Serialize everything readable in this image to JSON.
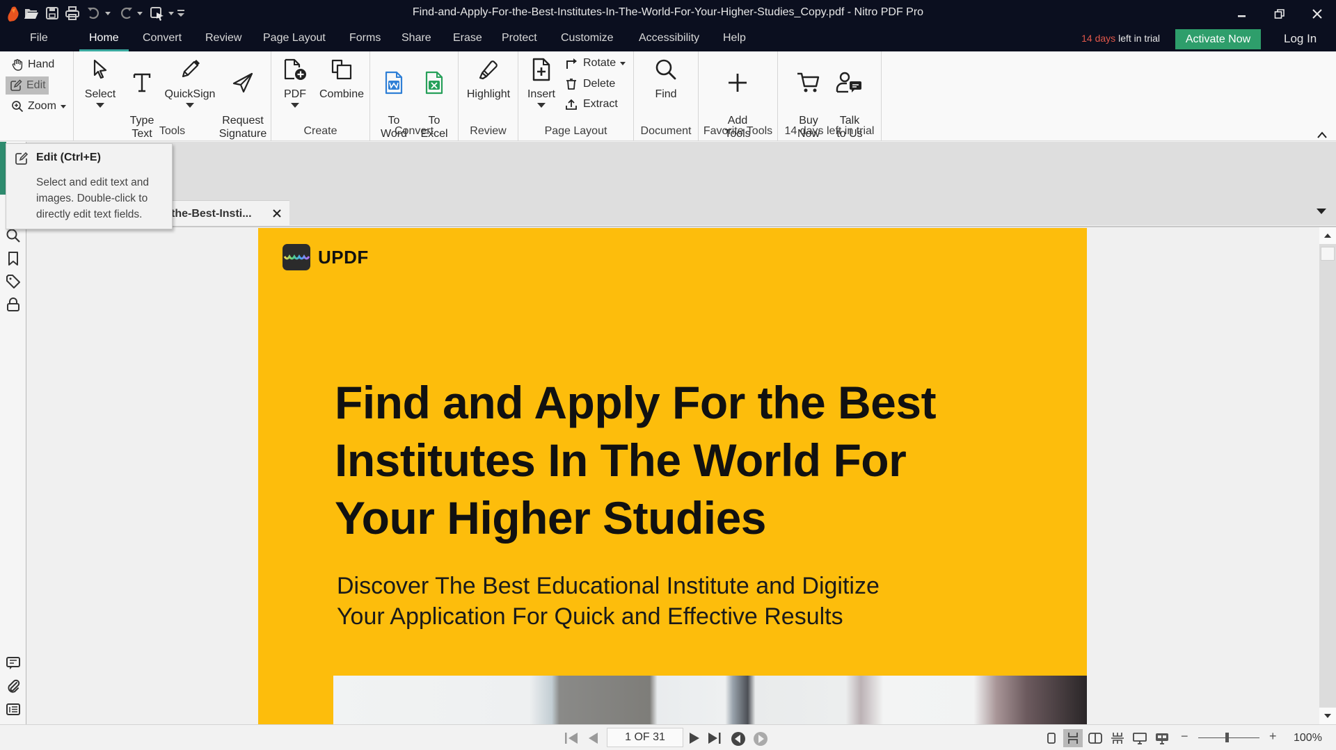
{
  "window": {
    "title": "Find-and-Apply-For-the-Best-Institutes-In-The-World-For-Your-Higher-Studies_Copy.pdf - Nitro PDF Pro",
    "app_name": "Nitro PDF Pro",
    "quick_access": [
      "nitro-logo",
      "open-folder",
      "save",
      "print",
      "undo",
      "redo",
      "select-customize",
      "overflow"
    ],
    "controls": [
      "minimize",
      "restore",
      "close"
    ]
  },
  "menu": {
    "tabs": [
      {
        "label": "File"
      },
      {
        "label": "Home",
        "active": true
      },
      {
        "label": "Convert"
      },
      {
        "label": "Review"
      },
      {
        "label": "Page Layout"
      },
      {
        "label": "Forms"
      },
      {
        "label": "Share"
      },
      {
        "label": "Erase"
      },
      {
        "label": "Protect"
      },
      {
        "label": "Customize"
      },
      {
        "label": "Accessibility"
      },
      {
        "label": "Help"
      }
    ],
    "trial_days": "14 days",
    "trial_suffix": " left in trial",
    "activate_label": "Activate Now",
    "login_label": "Log In",
    "colors": {
      "accent": "#3aa99f",
      "activate": "#2e9e6b",
      "trial_days": "#e0574a",
      "bar": "#0b0f1f"
    }
  },
  "ribbon": {
    "quick_tools": [
      {
        "label": "Hand",
        "icon": "hand-icon"
      },
      {
        "label": "Edit",
        "icon": "edit-icon",
        "selected": true
      },
      {
        "label": "Zoom",
        "icon": "zoom-icon",
        "has_dropdown": true
      }
    ],
    "groups": [
      {
        "label": "Tools",
        "buttons": [
          {
            "label": "Select",
            "icon": "cursor-icon",
            "has_dropdown": true
          },
          {
            "label": "Type\nText",
            "icon": "type-text-icon"
          },
          {
            "label": "QuickSign",
            "icon": "pen-icon",
            "has_dropdown": true
          },
          {
            "label": "Request\nSignature",
            "icon": "paper-plane-icon"
          }
        ]
      },
      {
        "label": "Create",
        "buttons": [
          {
            "label": "PDF",
            "icon": "pdf-create-icon",
            "has_dropdown": true
          },
          {
            "label": "Combine",
            "icon": "combine-icon"
          }
        ]
      },
      {
        "label": "Convert",
        "buttons": [
          {
            "label": "To\nWord",
            "icon": "word-icon"
          },
          {
            "label": "To\nExcel",
            "icon": "excel-icon"
          }
        ]
      },
      {
        "label": "Review",
        "buttons": [
          {
            "label": "Highlight",
            "icon": "highlighter-icon"
          }
        ]
      },
      {
        "label": "Page Layout",
        "buttons": [
          {
            "label": "Insert",
            "icon": "insert-page-icon",
            "has_dropdown": true
          }
        ],
        "inline_tools": [
          {
            "label": "Rotate",
            "icon": "rotate-icon",
            "has_dropdown": true
          },
          {
            "label": "Delete",
            "icon": "trash-icon"
          },
          {
            "label": "Extract",
            "icon": "extract-icon"
          }
        ]
      },
      {
        "label": "Document",
        "buttons": [
          {
            "label": "Find",
            "icon": "search-icon"
          }
        ]
      },
      {
        "label": "Favorite Tools",
        "buttons": [
          {
            "label": "Add\nTools",
            "icon": "plus-icon"
          }
        ]
      },
      {
        "label": "14 days left in trial",
        "buttons": [
          {
            "label": "Buy\nNow",
            "icon": "cart-icon"
          },
          {
            "label": "Talk\nto Us",
            "icon": "person-chat-icon"
          }
        ]
      }
    ]
  },
  "tooltip": {
    "title": "Edit (Ctrl+E)",
    "body": "Select and edit text and images. Double-click to directly edit text fields."
  },
  "document_tab": {
    "label": "the-Best-Insti...",
    "close": "close-icon"
  },
  "sidebar": {
    "top_icons": [
      "search-icon",
      "bookmark-icon",
      "tag-icon",
      "lock-icon"
    ],
    "bottom_icons": [
      "comment-icon",
      "attachment-icon",
      "list-icon"
    ]
  },
  "document": {
    "brand": "UPDF",
    "heading_lines": [
      "Find and Apply For the Best",
      "Institutes In The World For",
      "Your Higher Studies"
    ],
    "sub_lines": [
      "Discover The Best Educational Institute and Digitize",
      "Your Application For Quick and Effective Results"
    ],
    "background": "#fdbd0c"
  },
  "statusbar": {
    "page_indicator": "1 OF 31",
    "current_page": 1,
    "total_pages": 31,
    "zoom_minus": "−",
    "zoom_plus": "+",
    "zoom_level": "100%",
    "zoom_slider_fraction": 0.47,
    "view_modes": [
      "single-page",
      "continuous",
      "facing",
      "facing-continuous",
      "presentation",
      "presenter-view"
    ],
    "selected_view": "continuous"
  }
}
